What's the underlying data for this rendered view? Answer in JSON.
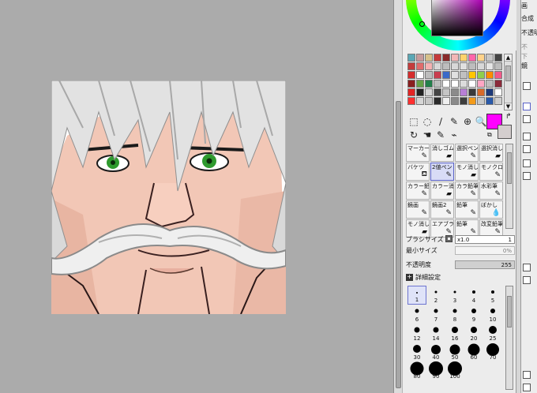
{
  "panel": {
    "brush_size_label": "ブラシサイズ",
    "brush_size_value": "x1.0",
    "brush_size_value_right": "1",
    "min_size_label": "最小サイズ",
    "min_size_value": "0%",
    "opacity_label": "不透明度",
    "opacity_value": "255",
    "detail_label": "詳細設定"
  },
  "swatches": [
    "#5aa7b5",
    "#c79b9b",
    "#d6c18b",
    "#c53a3a",
    "#8a2a2a",
    "#f2b6b6",
    "#ffd36b",
    "#ff66aa",
    "#ffd38b",
    "#c6c6c6",
    "#444",
    "#c43c3c",
    "#e06c6c",
    "#f5b2b2",
    "#d8d8d8",
    "#bdbdbd",
    "#d8d8d8",
    "#e0e0e0",
    "#bdbdbd",
    "#d8d8d8",
    "#e5e5e5",
    "#bdbdbd",
    "#d52d2d",
    "#ffffff",
    "#bdbdbd",
    "#c93d4f",
    "#3a6ac9",
    "#e0e0e0",
    "#c0c0c0",
    "#ffc600",
    "#8fcf4b",
    "#ff8c00",
    "#f25a8a",
    "#8a1f1f",
    "#64a047",
    "#23804b",
    "#bdbdbd",
    "#ffffff",
    "#ffffff",
    "#dcdcdc",
    "#ffffff",
    "#ffa6c4",
    "#bdbdbd",
    "#8b2a3a",
    "#e22424",
    "#222222",
    "#d6d6d6",
    "#444444",
    "#c5c5c5",
    "#8b8b8b",
    "#b87fd6",
    "#3a3a3a",
    "#d86a2a",
    "#1e3a7a",
    "#ffffff",
    "#ff2f2f",
    "#d6d6d6",
    "#c6c6c6",
    "#2a2a2a",
    "#efefef",
    "#8a8a8a",
    "#3d3d3d",
    "#f39b1a",
    "#c8c8c8",
    "#2a5aaa",
    "#cfcfcf"
  ],
  "tools": [
    "⬚",
    "◌",
    "∕",
    "✎",
    "⊕",
    "🔍",
    "↻",
    "☚",
    "✎",
    "⌁"
  ],
  "brushes": [
    {
      "name": "マーカー",
      "icon": "✎"
    },
    {
      "name": "消しゴム",
      "icon": "▰"
    },
    {
      "name": "選択ペン",
      "icon": "✎"
    },
    {
      "name": "選択消し",
      "icon": "▰"
    },
    {
      "name": "バケツ",
      "icon": "⛾"
    },
    {
      "name": "2値ペン",
      "icon": "✎"
    },
    {
      "name": "モノ消し",
      "icon": "▰"
    },
    {
      "name": "モノクロ",
      "icon": "✎"
    },
    {
      "name": "カラー鉛",
      "icon": "✎"
    },
    {
      "name": "カラー消",
      "icon": "▰"
    },
    {
      "name": "カラ鉛筆",
      "icon": "✎"
    },
    {
      "name": "水彩筆",
      "icon": "✎"
    },
    {
      "name": "鏡画",
      "icon": "✎"
    },
    {
      "name": "鏡画2",
      "icon": "✎"
    },
    {
      "name": "鉛筆",
      "icon": "✎"
    },
    {
      "name": "ぼかし",
      "icon": "💧"
    },
    {
      "name": "モノ消し",
      "icon": "▰"
    },
    {
      "name": "エアブラ",
      "icon": "✎"
    },
    {
      "name": "鉛筆",
      "icon": "✎"
    },
    {
      "name": "改変鉛筆",
      "icon": "✎"
    }
  ],
  "sizes": [
    "1",
    "2",
    "3",
    "4",
    "5",
    "6",
    "7",
    "8",
    "9",
    "10",
    "12",
    "14",
    "16",
    "20",
    "25",
    "30",
    "40",
    "50",
    "60",
    "70",
    "80",
    "90",
    "100"
  ],
  "right": {
    "line1": "画",
    "line2": "合成",
    "line3": "不透明",
    "line4": "不",
    "line5": "下",
    "line6": "鏡"
  }
}
